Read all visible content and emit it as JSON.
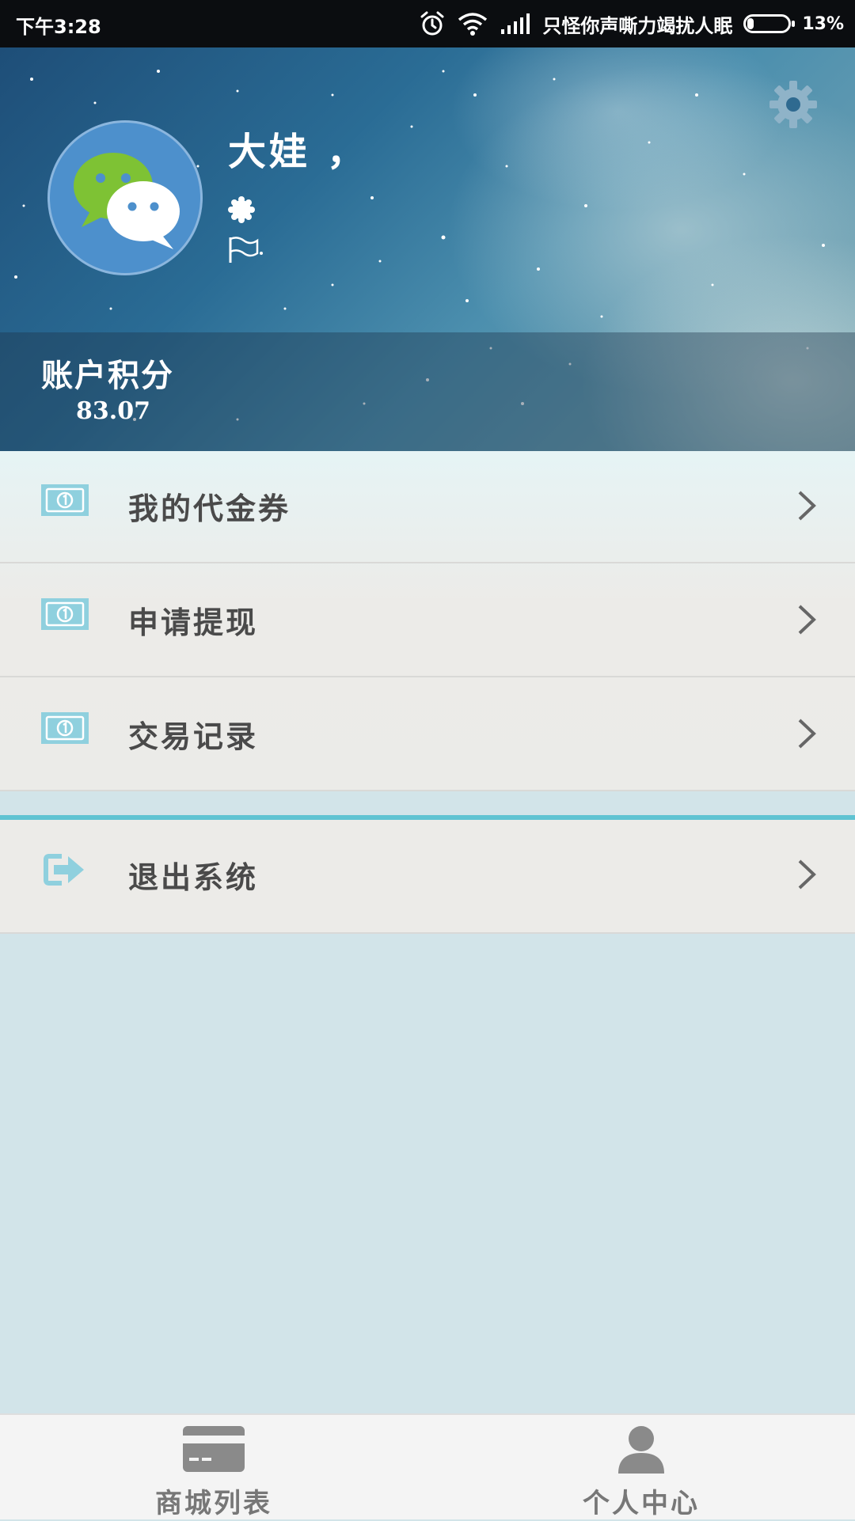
{
  "status_bar": {
    "time": "下午3:28",
    "carrier": "只怪你声嘶力竭扰人眠",
    "battery_percent": "13%",
    "icons": [
      "alarm-icon",
      "wifi-icon",
      "signal-icon",
      "battery-icon"
    ]
  },
  "profile": {
    "name": "大娃 ，",
    "avatar_icon": "wechat-icon",
    "badge_icon": "badge-icon",
    "flag_icon": "flag-icon",
    "settings_icon": "gear-icon"
  },
  "account": {
    "points_label": "账户积分",
    "points_value": "83.07"
  },
  "menu": {
    "items": [
      {
        "label": "我的代金券",
        "icon": "banknote-icon"
      },
      {
        "label": "申请提现",
        "icon": "banknote-icon"
      },
      {
        "label": "交易记录",
        "icon": "banknote-icon"
      }
    ],
    "logout": {
      "label": "退出系统",
      "icon": "logout-icon"
    }
  },
  "bottom_nav": {
    "items": [
      {
        "label": "商城列表",
        "icon": "card-icon"
      },
      {
        "label": "个人中心",
        "icon": "person-icon"
      }
    ]
  },
  "colors": {
    "accent": "#5fc3d2",
    "icon_teal": "#8fd0de",
    "text_dark": "#4a4a4a",
    "page_bg": "#d2e4e9"
  }
}
